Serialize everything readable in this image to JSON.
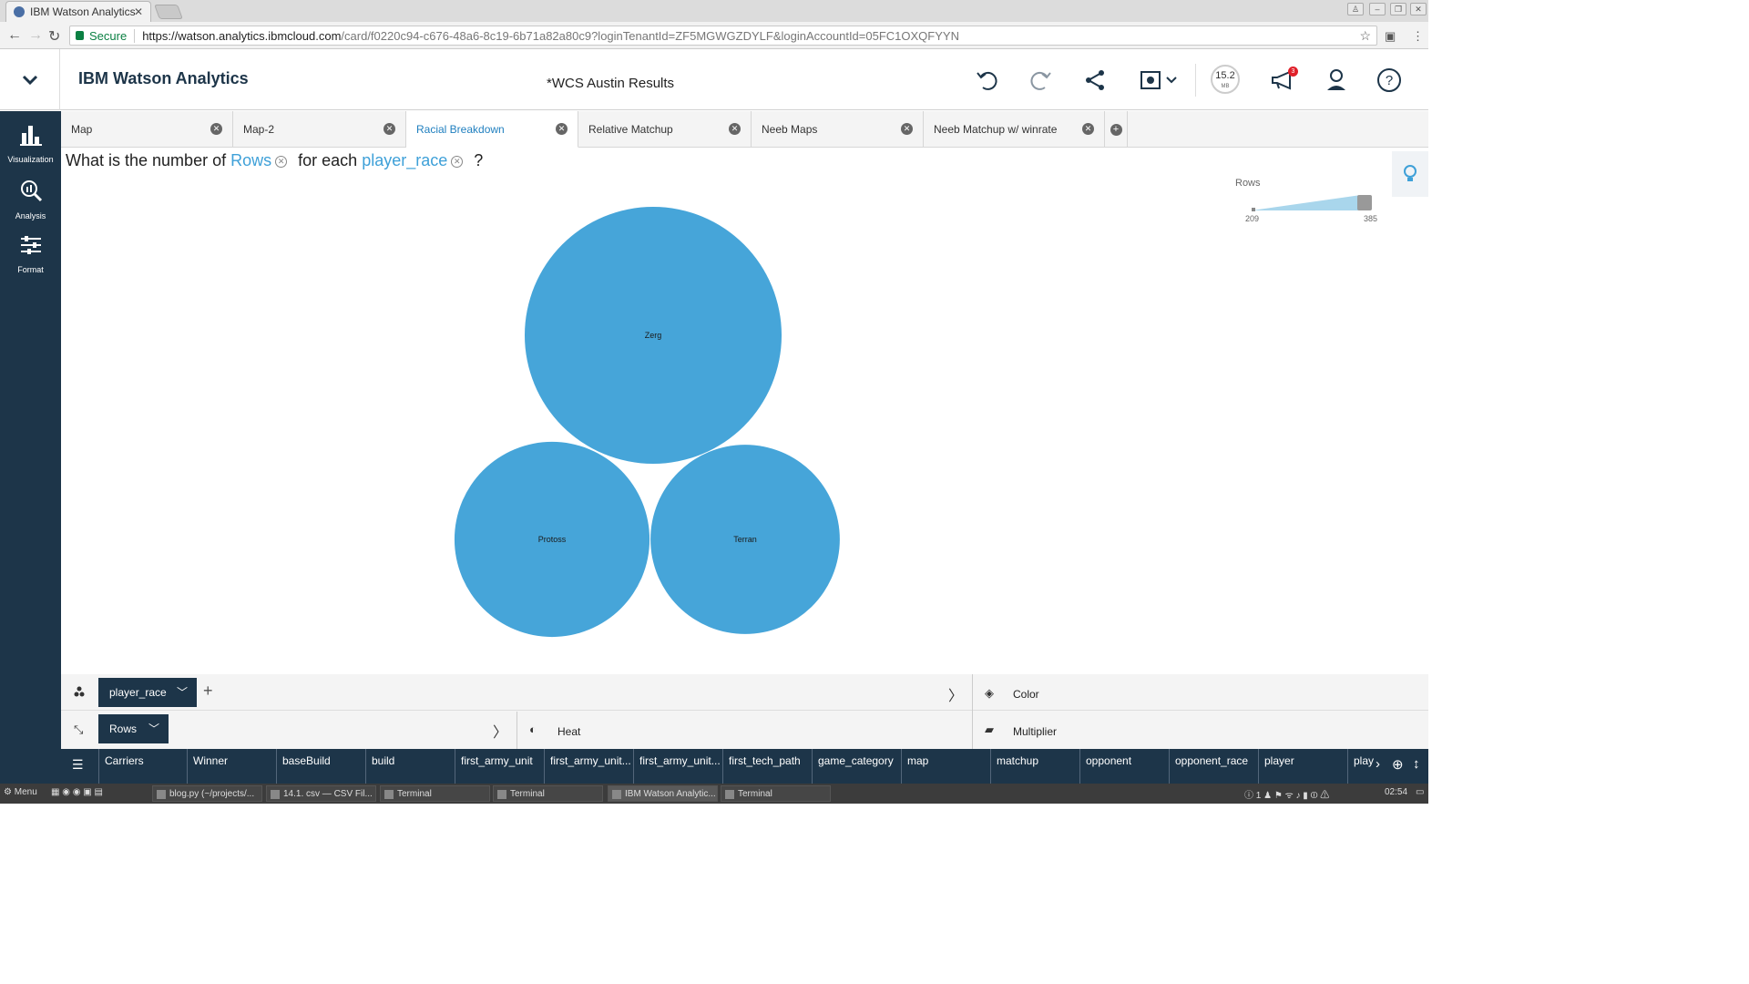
{
  "browser": {
    "tab_title": "IBM Watson Analytics",
    "tab_close": "✕",
    "secure_label": "Secure",
    "url_host": "https://watson.analytics.ibmcloud.com",
    "url_path": "/card/f0220c94-c676-48a6-8c19-6b71a82a80c9?loginTenantId=ZF5MGWGZDYLF&loginAccountId=05FC1OXQFYYN"
  },
  "header": {
    "brand": "IBM Watson Analytics",
    "title": "*WCS Austin Results",
    "memory_value": "15.2",
    "memory_unit": "MB",
    "notification_count": "3"
  },
  "leftnav": {
    "items": [
      {
        "label": "Visualization",
        "icon": "bar-chart-icon"
      },
      {
        "label": "Analysis",
        "icon": "magnifier-chart-icon"
      },
      {
        "label": "Format",
        "icon": "sliders-icon"
      }
    ]
  },
  "card_tabs": [
    {
      "label": "Map",
      "active": false
    },
    {
      "label": "Map-2",
      "active": false
    },
    {
      "label": "Racial Breakdown",
      "active": true
    },
    {
      "label": "Relative Matchup",
      "active": false
    },
    {
      "label": "Neeb Maps",
      "active": false
    },
    {
      "label": "Neeb Matchup w/ winrate",
      "active": false
    }
  ],
  "question": {
    "prefix": "What is the number of",
    "measure": "Rows",
    "middle": "for each",
    "dimension": "player_race",
    "suffix": "?"
  },
  "legend": {
    "title": "Rows",
    "min": "209",
    "max": "385"
  },
  "chart_data": {
    "type": "bubble",
    "size_measure": "Rows",
    "category_field": "player_race",
    "size_range": [
      209,
      385
    ],
    "bubbles": [
      {
        "label": "Zerg",
        "value": 385
      },
      {
        "label": "Protoss",
        "value": 222
      },
      {
        "label": "Terran",
        "value": 209
      }
    ],
    "color": "#46a5d9"
  },
  "slots": {
    "bubbles_field": "player_race",
    "size_field": "Rows",
    "color_label": "Color",
    "heat_label": "Heat",
    "multiplier_label": "Multiplier"
  },
  "columns": [
    "Carriers",
    "Winner",
    "baseBuild",
    "build",
    "first_army_unit",
    "first_army_unit...",
    "first_army_unit...",
    "first_tech_path",
    "game_category",
    "map",
    "matchup",
    "opponent",
    "opponent_race",
    "player",
    "play"
  ],
  "taskbar": {
    "menu_label": "Menu",
    "windows": [
      {
        "label": "blog.py (~/projects/...",
        "active": false
      },
      {
        "label": "14.1. csv — CSV Fil...",
        "active": false
      },
      {
        "label": "Terminal",
        "active": false
      },
      {
        "label": "Terminal",
        "active": false
      },
      {
        "label": "IBM Watson Analytic...",
        "active": true
      },
      {
        "label": "Terminal",
        "active": false
      }
    ],
    "workspace": "1",
    "clock": "02:54"
  },
  "colors": {
    "nav_dark": "#1d3549",
    "accent_blue": "#3ea0d8",
    "bubble": "#46a5d9"
  }
}
